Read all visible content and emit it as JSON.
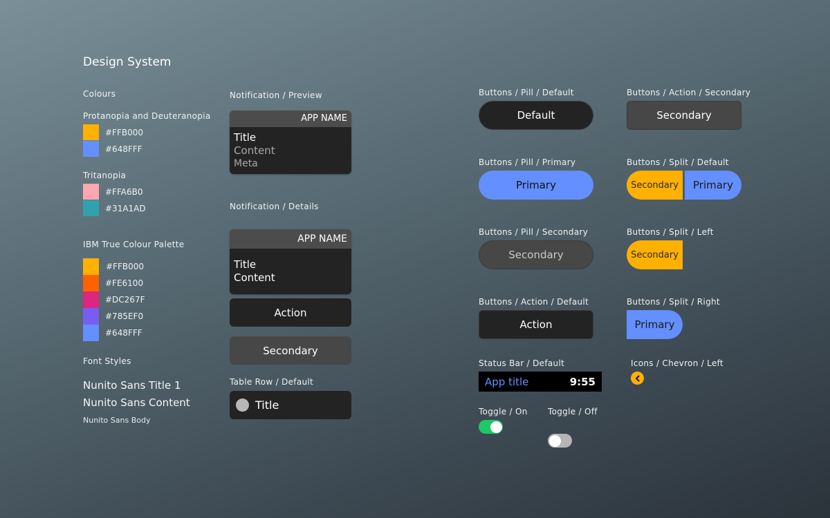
{
  "page_title": "Design System",
  "colours": {
    "heading": "Colours",
    "protan_heading": "Protanopia and Deuteranopia",
    "protan": [
      {
        "hex": "#FFB000",
        "label": "#FFB000"
      },
      {
        "hex": "#648FFF",
        "label": "#648FFF"
      }
    ],
    "tritan_heading": "Tritanopia",
    "tritan": [
      {
        "hex": "#FFA6B0",
        "label": "#FFA6B0"
      },
      {
        "hex": "#31A1AD",
        "label": "#31A1AD"
      }
    ],
    "ibm_heading": "IBM True Colour Palette",
    "ibm": [
      {
        "hex": "#FFB000",
        "label": "#FFB000"
      },
      {
        "hex": "#FE6100",
        "label": "#FE6100"
      },
      {
        "hex": "#DC267F",
        "label": "#DC267F"
      },
      {
        "hex": "#785EF0",
        "label": "#785EF0"
      },
      {
        "hex": "#648FFF",
        "label": "#648FFF"
      }
    ]
  },
  "fonts": {
    "heading": "Font Styles",
    "title": "Nunito Sans Title 1",
    "content": "Nunito Sans Content",
    "body": "Nunito Sans Body"
  },
  "notification_preview": {
    "label": "Notification / Preview",
    "app_name": "APP NAME",
    "title": "Title",
    "content": "Content",
    "meta": "Meta"
  },
  "notification_details": {
    "label": "Notification / Details",
    "app_name": "APP NAME",
    "title": "Title",
    "content": "Content",
    "action_button": "Action",
    "secondary_button": "Secondary"
  },
  "table_row": {
    "label": "Table Row / Default",
    "title": "Title"
  },
  "buttons": {
    "pill_default_label": "Buttons / Pill / Default",
    "pill_default_text": "Default",
    "pill_primary_label": "Buttons / Pill / Primary",
    "pill_primary_text": "Primary",
    "pill_secondary_label": "Buttons / Pill / Secondary",
    "pill_secondary_text": "Secondary",
    "action_default_label": "Buttons / Action / Default",
    "action_default_text": "Action",
    "action_secondary_label": "Buttons / Action / Secondary",
    "action_secondary_text": "Secondary",
    "split_default_label": "Buttons / Split / Default",
    "split_default_left": "Secondary",
    "split_default_right": "Primary",
    "split_left_label": "Buttons / Split / Left",
    "split_left_text": "Secondary",
    "split_right_label": "Buttons / Split / Right",
    "split_right_text": "Primary"
  },
  "status_bar": {
    "label": "Status Bar / Default",
    "app_title": "App title",
    "time": "9:55"
  },
  "icons": {
    "label": "Icons / Chevron / Left",
    "chevron_icon": "chevron-left-icon"
  },
  "toggles": {
    "on_label": "Toggle / On",
    "off_label": "Toggle / Off",
    "on_color": "#1FC765",
    "off_color": "#B5B5B5"
  },
  "colors": {
    "primary": "#648FFF",
    "secondary_accent": "#FFB000",
    "dark_surface": "#232323"
  }
}
